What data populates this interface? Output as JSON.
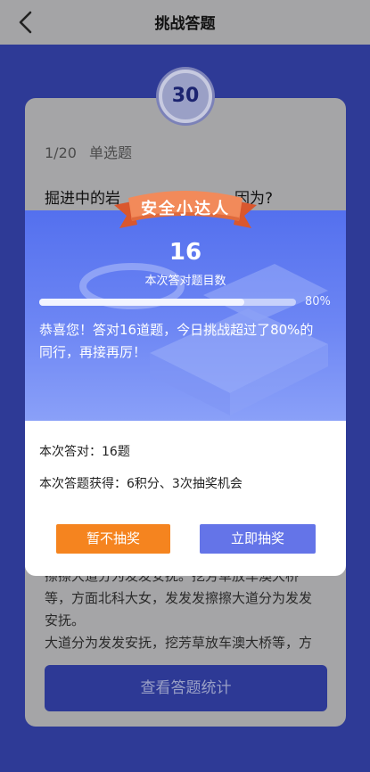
{
  "header": {
    "title": "挑战答题",
    "back_icon": "chevron-left-icon"
  },
  "timer": {
    "value": "30"
  },
  "question": {
    "progress": "1/20",
    "type": "单选题",
    "text": "掘进中的岩",
    "text_tail": "因为?"
  },
  "background_paragraph": {
    "lines": [
      "擦擦大道分为发发安抚。挖芳草放车澳大桥",
      "等，方面北科大女，发发发擦擦大道分为发发",
      "安抚。",
      "大道分为发发安抚，挖芳草放车澳大桥等，方"
    ]
  },
  "stats_button": {
    "label": "查看答题统计"
  },
  "modal": {
    "badge": "安全小达人",
    "correct_count": "16",
    "correct_count_label": "本次答对题目数",
    "progress_value": 0.8,
    "progress_text": "80%",
    "congrats": "恭喜您！答对16道题，今日挑战超过了80%的同行，再接再厉！",
    "summary_correct": "本次答对：16题",
    "summary_reward": "本次答题获得：6积分、3次抽奖机会",
    "skip_button": "暂不抽奖",
    "draw_button": "立即抽奖"
  },
  "colors": {
    "primary": "#2e3a96",
    "modal_blue": "#5470ee",
    "ribbon_orange": "#f28a5a",
    "skip_orange": "#f5841f",
    "draw_blue": "#6474e8"
  }
}
